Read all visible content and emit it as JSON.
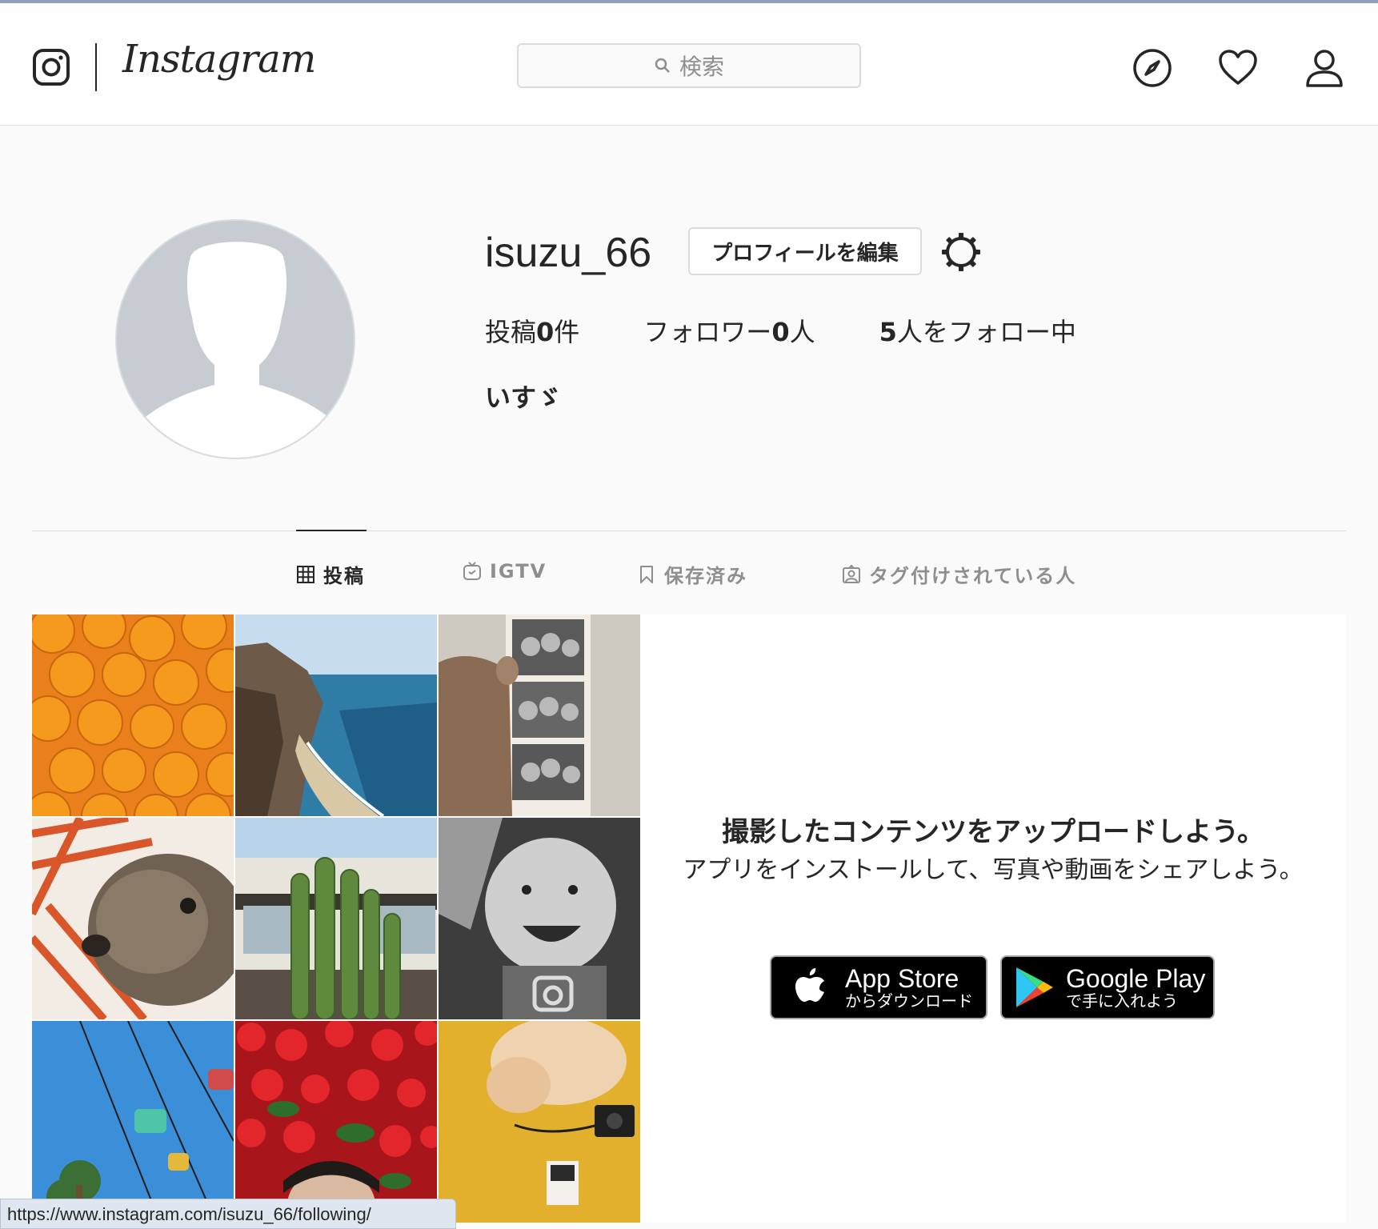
{
  "header": {
    "wordmark": "Instagram",
    "search_placeholder": "検索"
  },
  "profile": {
    "username": "isuzu_66",
    "edit_label": "プロフィールを編集",
    "stats": {
      "posts_prefix": "投稿",
      "posts_count": "0",
      "posts_suffix": "件",
      "followers_prefix": "フォロワー",
      "followers_count": "0",
      "followers_suffix": "人",
      "following_count": "5",
      "following_suffix": "人をフォロー中"
    },
    "full_name": "いすゞ"
  },
  "tabs": [
    {
      "label": "投稿",
      "icon": "grid-icon",
      "active": true
    },
    {
      "label": "IGTV",
      "icon": "igtv-icon",
      "active": false
    },
    {
      "label": "保存済み",
      "icon": "bookmark-icon",
      "active": false
    },
    {
      "label": "タグ付けされている人",
      "icon": "tagged-icon",
      "active": false
    }
  ],
  "promo": {
    "title": "撮影したコンテンツをアップロードしよう。",
    "subtitle": "アプリをインストールして、写真や動画をシェアしよう。",
    "app_store_big": "App Store",
    "app_store_small": "からダウンロード",
    "google_play_big": "Google Play",
    "google_play_small": "で手に入れよう"
  },
  "sample_photos": [
    "oranges",
    "coastline",
    "photo-booth-strip",
    "dog",
    "cactus",
    "baby",
    "gondola",
    "red-flowers",
    "cat"
  ],
  "status_bar_url": "https://www.instagram.com/isuzu_66/following/",
  "colors": {
    "text": "#262626",
    "muted": "#8e8e8e",
    "border": "#dbdbdb",
    "background": "#fafafa"
  }
}
